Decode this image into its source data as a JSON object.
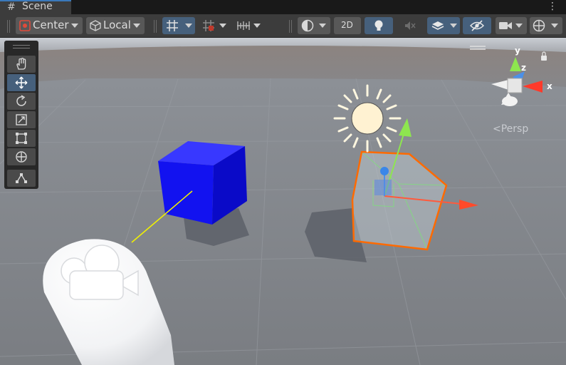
{
  "tab": {
    "hash_icon": "#",
    "title": "Scene"
  },
  "toolbar": {
    "pivot_mode": "Center",
    "pivot_rotation": "Local",
    "mode_2d": "2D"
  },
  "gizmo": {
    "y": "y",
    "z": "z",
    "x": "x",
    "projection": "Persp"
  },
  "colors": {
    "sky": "#8e9299",
    "ground": "#7a7d82",
    "blue_cube": "#1a1aff",
    "selection_outline": "#ff6a00",
    "accent": "#46607c"
  }
}
